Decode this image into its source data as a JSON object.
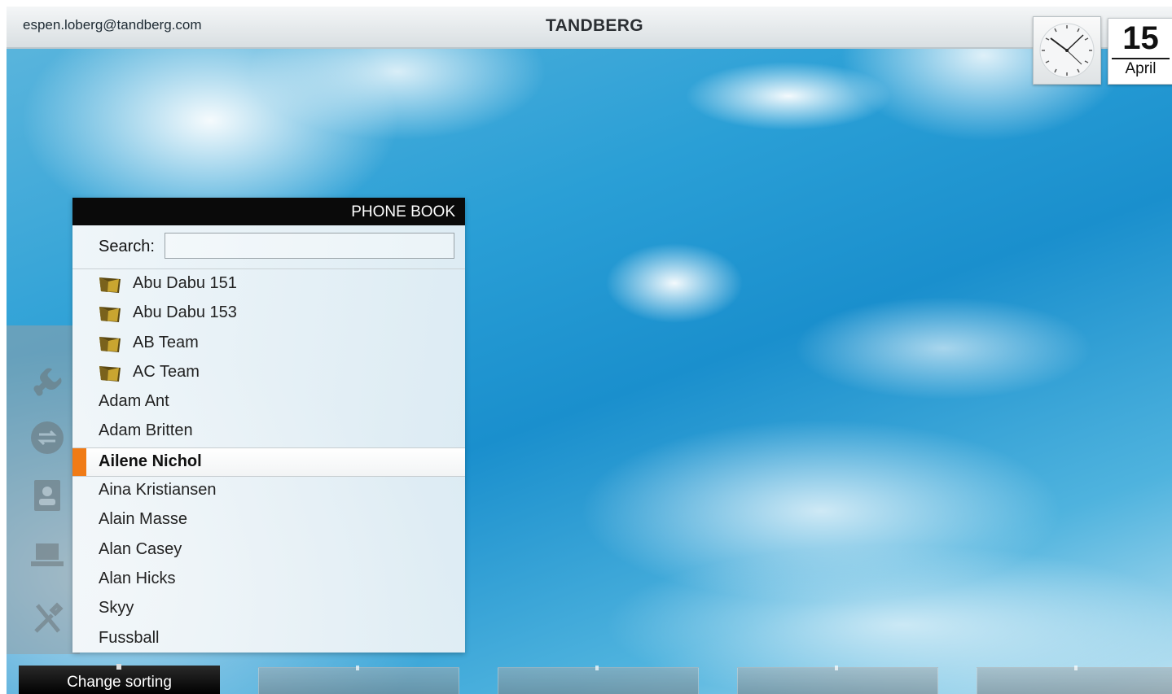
{
  "header": {
    "user_email": "espen.loberg@tandberg.com",
    "brand": "TANDBERG"
  },
  "datetime": {
    "day": "15",
    "month": "April"
  },
  "phonebook": {
    "title": "PHONE BOOK",
    "search_label": "Search:",
    "search_value": "",
    "items": [
      {
        "label": "Abu Dabu 151",
        "type": "folder"
      },
      {
        "label": "Abu Dabu 153",
        "type": "folder"
      },
      {
        "label": "AB Team",
        "type": "folder"
      },
      {
        "label": "AC Team",
        "type": "folder"
      },
      {
        "label": "Adam Ant",
        "type": "contact"
      },
      {
        "label": "Adam Britten",
        "type": "contact"
      },
      {
        "label": "Ailene Nichol",
        "type": "contact",
        "selected": true
      },
      {
        "label": "Aina Kristiansen",
        "type": "contact"
      },
      {
        "label": "Alain Masse",
        "type": "contact"
      },
      {
        "label": "Alan Casey",
        "type": "contact"
      },
      {
        "label": "Alan Hicks",
        "type": "contact"
      },
      {
        "label": "Skyy",
        "type": "contact"
      },
      {
        "label": "Fussball",
        "type": "contact"
      }
    ]
  },
  "softkeys": {
    "change_sorting": "Change sorting"
  },
  "sidebar": {
    "icons": [
      "phone-icon",
      "swap-icon",
      "contact-card-icon",
      "laptop-icon",
      "tools-icon"
    ]
  },
  "colors": {
    "accent": "#f07b16",
    "header_bg": "#0a0a0a",
    "folder": "#5a4712"
  }
}
